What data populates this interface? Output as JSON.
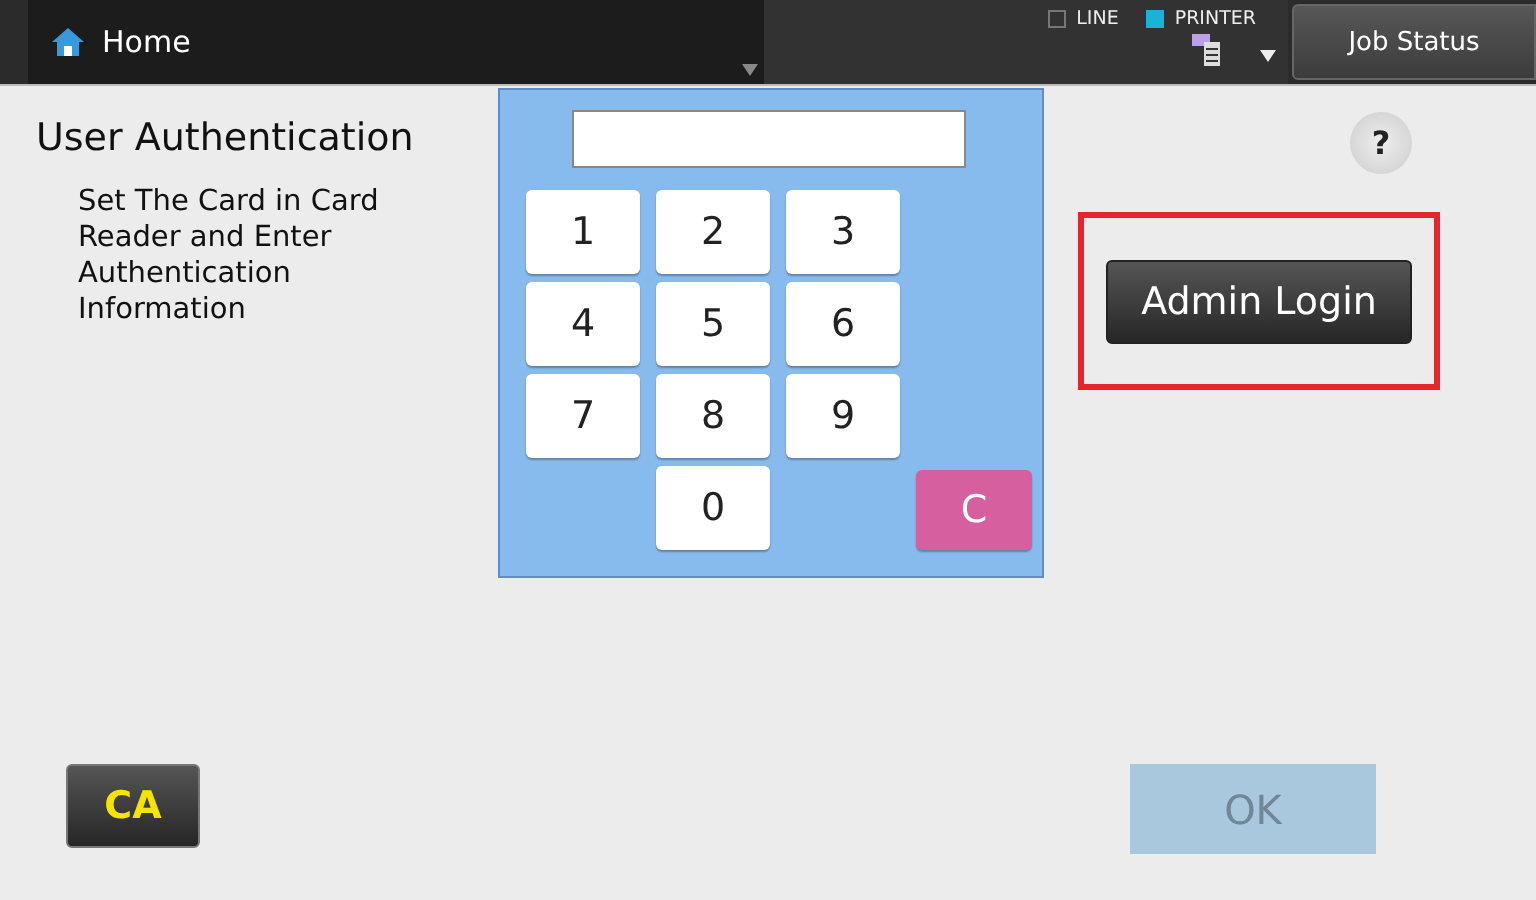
{
  "top_bar": {
    "home": "Home",
    "indicators": [
      {
        "label": "LINE",
        "checked": false
      },
      {
        "label": "PRINTER",
        "checked": true
      }
    ],
    "job_status": "Job Status"
  },
  "title": "User Authentication",
  "instruction": "Set The Card in Card Reader and Enter Authentication Information",
  "keypad": {
    "keys": [
      {
        "label": "1",
        "kind": "digit"
      },
      {
        "label": "2",
        "kind": "digit"
      },
      {
        "label": "3",
        "kind": "digit"
      },
      {
        "label": "4",
        "kind": "digit"
      },
      {
        "label": "5",
        "kind": "digit"
      },
      {
        "label": "6",
        "kind": "digit"
      },
      {
        "label": "7",
        "kind": "digit"
      },
      {
        "label": "8",
        "kind": "digit"
      },
      {
        "label": "9",
        "kind": "digit"
      },
      {
        "label": "0",
        "kind": "digit"
      },
      {
        "label": "C",
        "kind": "clear"
      }
    ]
  },
  "help": "?",
  "admin_login": {
    "label": "Admin Login",
    "highlighted": true
  },
  "ca_button": "CA",
  "ok_button": {
    "label": "OK",
    "disabled": true
  }
}
